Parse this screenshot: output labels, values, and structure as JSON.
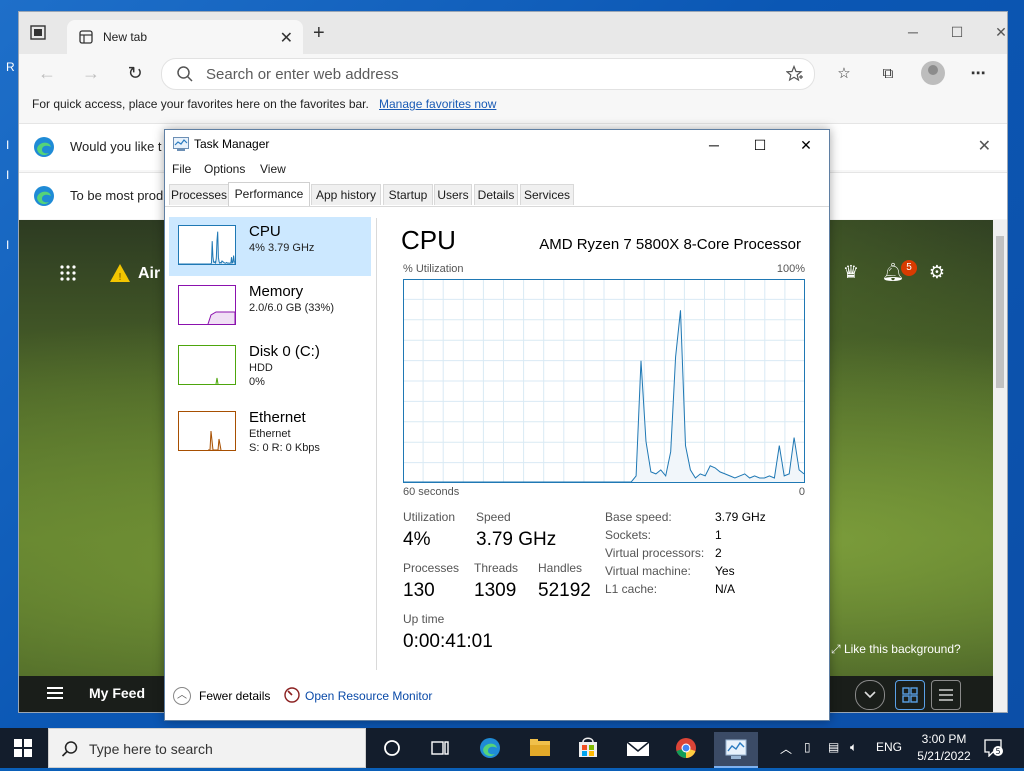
{
  "desktop": {
    "glyphs": [
      "R",
      "I",
      "I",
      "I"
    ]
  },
  "browser": {
    "tab_title": "New tab",
    "address_placeholder": "Search or enter web address",
    "favbar_text": "For quick access, place your favorites here on the favorites bar.",
    "favbar_link": "Manage favorites now",
    "infobar1_text": "Would you like t",
    "infobar2_text": "To be most prod",
    "newtab": {
      "weather_label": "Air",
      "notification_count": "5",
      "background_prompt": "Like this background?",
      "feed_label": "My Feed"
    }
  },
  "task_manager": {
    "title": "Task Manager",
    "menu": [
      "File",
      "Options",
      "View"
    ],
    "tabs": [
      "Processes",
      "Performance",
      "App history",
      "Startup",
      "Users",
      "Details",
      "Services"
    ],
    "active_tab": "Performance",
    "resources": [
      {
        "name": "CPU",
        "line1": "4% 3.79 GHz",
        "line2": "",
        "color": "#1f78b4"
      },
      {
        "name": "Memory",
        "line1": "2.0/6.0 GB (33%)",
        "line2": "",
        "color": "#8b12ae"
      },
      {
        "name": "Disk 0 (C:)",
        "line1": "HDD",
        "line2": "0%",
        "color": "#4da60c"
      },
      {
        "name": "Ethernet",
        "line1": "Ethernet",
        "line2": "S: 0 R: 0 Kbps",
        "color": "#a74f01"
      }
    ],
    "cpu": {
      "heading": "CPU",
      "model": "AMD Ryzen 7 5800X 8-Core Processor",
      "graph_label": "% Utilization",
      "graph_max": "100%",
      "graph_span": "60 seconds",
      "graph_min": "0",
      "utilization_label": "Utilization",
      "utilization_value": "4%",
      "speed_label": "Speed",
      "speed_value": "3.79 GHz",
      "processes_label": "Processes",
      "processes_value": "130",
      "threads_label": "Threads",
      "threads_value": "1309",
      "handles_label": "Handles",
      "handles_value": "52192",
      "uptime_label": "Up time",
      "uptime_value": "0:00:41:01",
      "details": [
        {
          "k": "Base speed:",
          "v": "3.79 GHz"
        },
        {
          "k": "Sockets:",
          "v": "1"
        },
        {
          "k": "Virtual processors:",
          "v": "2"
        },
        {
          "k": "Virtual machine:",
          "v": "Yes"
        },
        {
          "k": "L1 cache:",
          "v": "N/A"
        }
      ],
      "history_percent": [
        0,
        0,
        0,
        0,
        0,
        0,
        0,
        0,
        0,
        0,
        0,
        0,
        0,
        0,
        0,
        0,
        0,
        0,
        0,
        0,
        0,
        0,
        0,
        0,
        0,
        0,
        0,
        0,
        0,
        0,
        0,
        0,
        0,
        0,
        0,
        0,
        0,
        0,
        0,
        0,
        0,
        0,
        0,
        0,
        0,
        0,
        0,
        3,
        60,
        20,
        5,
        4,
        6,
        3,
        15,
        62,
        85,
        18,
        6,
        2,
        4,
        3,
        8,
        7,
        5,
        4,
        3,
        2,
        3,
        4,
        2,
        3,
        2,
        2,
        3,
        2,
        18,
        3,
        4,
        22,
        6,
        4
      ]
    },
    "footer": {
      "fewer_details": "Fewer details",
      "resource_monitor": "Open Resource Monitor"
    },
    "colors": {
      "cpu": "#1f78b4",
      "cpu_fill": "#f1f6fa",
      "grid": "#d9eaf4"
    }
  },
  "taskbar": {
    "search_placeholder": "Type here to search",
    "language": "ENG",
    "time": "3:00 PM",
    "date": "5/21/2022",
    "notification_count": "5"
  }
}
